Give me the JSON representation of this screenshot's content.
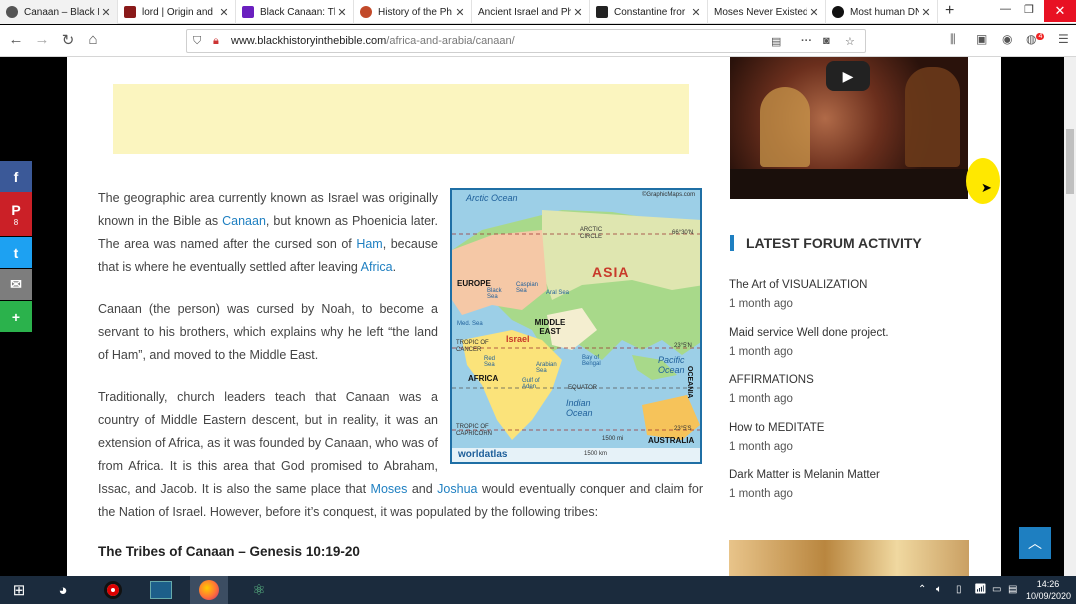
{
  "tabs": [
    {
      "title": "Canaan – Black H",
      "color": "#555"
    },
    {
      "title": "lord | Origin and",
      "color": "#8a1a1a"
    },
    {
      "title": "Black Canaan: Th",
      "color": "#6a1fbf"
    },
    {
      "title": "History of the Ph",
      "color": "#c24a2a"
    },
    {
      "title": "Ancient Israel and Ph",
      "color": "#999"
    },
    {
      "title": "Constantine fror",
      "color": "#222"
    },
    {
      "title": "Moses Never Existed",
      "color": "#999"
    },
    {
      "title": "Most human DN",
      "color": "#111"
    }
  ],
  "url": {
    "domain": "www.blackhistoryinthebible.com",
    "path": "/africa-and-arabia/canaan/"
  },
  "article": {
    "p1": {
      "t1": "The geographic area currently known as Israel was originally known in the Bible as ",
      "l1": "Canaan",
      "t2": ", but known as Phoenicia later. The area was named after the cursed son of ",
      "l2": "Ham",
      "t3": ", because that is where he eventually settled after leaving ",
      "l3": "Africa",
      "t4": "."
    },
    "p2": "Canaan (the person) was cursed by Noah, to become a servant to his brothers, which explains why he left “the land of Ham”, and moved to the Middle East.",
    "p3": {
      "t1": "Traditionally, church leaders teach that Canaan was a country of Middle Eastern descent, but in reality, it was an extension of Africa, as it was founded by Canaan, who was of from Africa. It is this area that God promised to Abraham, Issac, and Jacob. It is also the same place that ",
      "l1": "Moses",
      "t2": " and ",
      "l2": "Joshua",
      "t3": " would eventually conquer and claim for the Nation of Israel. However, before it’s conquest, it was populated by the following tribes:"
    },
    "heading": "The Tribes of Canaan – Genesis 10:19-20"
  },
  "map": {
    "credit": "©GraphicMaps.com",
    "arctic_ocean": "Arctic Ocean",
    "arctic_circle": "ARCTIC CIRCLE",
    "lat1": "66°30'N",
    "asia": "ASIA",
    "europe": "EUROPE",
    "caspian": "Caspian Sea",
    "black": "Black Sea",
    "aral": "Aral Sea",
    "med": "Med. Sea",
    "middle_east": "MIDDLE EAST",
    "israel": "Israel",
    "cancer": "TROPIC OF CANCER",
    "lat2": "23°5'N",
    "red": "Red Sea",
    "arabian": "Arabian Sea",
    "bengal": "Bay of Bengal",
    "pacific": "Pacific Ocean",
    "africa": "AFRICA",
    "aden": "Gulf of Aden",
    "equator": "EQUATOR",
    "oceania": "OCEANIA",
    "indian": "Indian Ocean",
    "capricorn": "TROPIC OF CAPRICORN",
    "lat3": "23°5'S",
    "australia": "AUSTRALIA",
    "scale1": "1500 mi",
    "scale2": "1500 km",
    "worldatlas": "worldatlas"
  },
  "sidebar": {
    "heading": "LATEST FORUM ACTIVITY",
    "items": [
      {
        "title": "The Art of VISUALIZATION",
        "date": "1 month ago"
      },
      {
        "title": "Maid service Well done project.",
        "date": "1 month ago"
      },
      {
        "title": "AFFIRMATIONS",
        "date": "1 month ago"
      },
      {
        "title": "How to MEDITATE",
        "date": "1 month ago"
      },
      {
        "title": "Dark Matter is Melanin Matter",
        "date": "1 month ago"
      }
    ]
  },
  "social": [
    {
      "icon": "facebook-icon",
      "glyph": "f",
      "color": "#3b5998"
    },
    {
      "icon": "pinterest-icon",
      "glyph": "P",
      "count": "8",
      "color": "#cb2027"
    },
    {
      "icon": "twitter-icon",
      "glyph": "t",
      "color": "#1da1f2"
    },
    {
      "icon": "email-icon",
      "glyph": "✉",
      "color": "#7d7d7d"
    },
    {
      "icon": "more-share-icon",
      "glyph": "+",
      "color": "#2bb24c"
    }
  ],
  "browser_badge": "4",
  "clock": {
    "time": "14:26",
    "date": "10/09/2020"
  }
}
